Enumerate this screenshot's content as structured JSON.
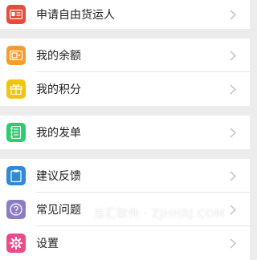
{
  "menu": {
    "apply": {
      "label": "申请自由货运人",
      "icon": "id-card-icon",
      "color": "#e74c3c"
    },
    "balance": {
      "label": "我的余额",
      "icon": "wallet-icon",
      "color": "#f39c33"
    },
    "points": {
      "label": "我的积分",
      "icon": "gift-icon",
      "color": "#f1c40f"
    },
    "orders": {
      "label": "我的发单",
      "icon": "notebook-icon",
      "color": "#2ecc71"
    },
    "feedback": {
      "label": "建议反馈",
      "icon": "clipboard-icon",
      "color": "#2f8ad8"
    },
    "faq": {
      "label": "常见问题",
      "icon": "question-icon",
      "color": "#8e7cc3"
    },
    "settings": {
      "label": "设置",
      "icon": "gear-icon",
      "color": "#e84c8a"
    }
  },
  "watermark": {
    "text": "当汇软件 · ZJHHRJ.COM"
  },
  "colors": {
    "background": "#ececec",
    "chevron": "#c7c7cc"
  }
}
